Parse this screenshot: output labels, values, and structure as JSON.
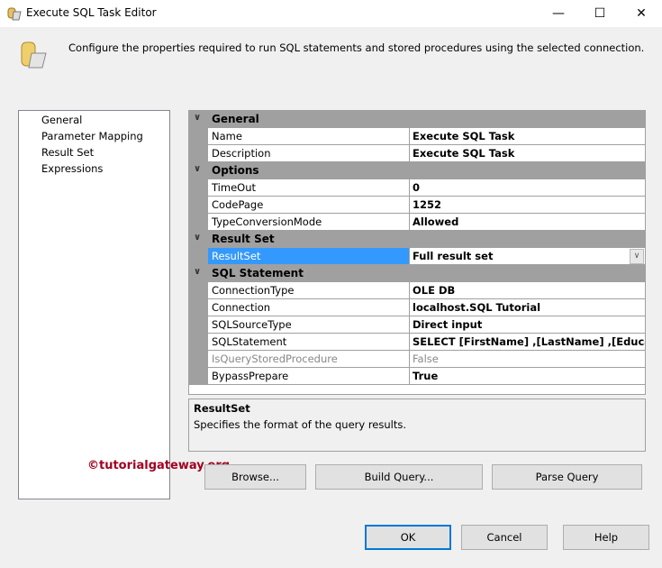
{
  "window": {
    "title": "Execute SQL Task Editor",
    "minimize": "—",
    "maximize": "☐",
    "close": "✕"
  },
  "header": {
    "text": "Configure the properties required to run SQL statements and stored procedures using the selected connection."
  },
  "nav": {
    "items": [
      "General",
      "Parameter Mapping",
      "Result Set",
      "Expressions"
    ]
  },
  "grid": {
    "general": {
      "label": "General",
      "rows": [
        {
          "name": "Name",
          "value": "Execute SQL Task"
        },
        {
          "name": "Description",
          "value": "Execute SQL Task"
        }
      ]
    },
    "options": {
      "label": "Options",
      "rows": [
        {
          "name": "TimeOut",
          "value": "0"
        },
        {
          "name": "CodePage",
          "value": "1252"
        },
        {
          "name": "TypeConversionMode",
          "value": "Allowed"
        }
      ]
    },
    "resultset": {
      "label": "Result Set",
      "rows": [
        {
          "name": "ResultSet",
          "value": "Full result set"
        }
      ]
    },
    "sql": {
      "label": "SQL Statement",
      "rows": [
        {
          "name": "ConnectionType",
          "value": "OLE DB"
        },
        {
          "name": "Connection",
          "value": "localhost.SQL Tutorial"
        },
        {
          "name": "SQLSourceType",
          "value": "Direct input"
        },
        {
          "name": "SQLStatement",
          "value": "SELECT [FirstName]      ,[LastName]      ,[Education]"
        },
        {
          "name": "IsQueryStoredProcedure",
          "value": "False"
        },
        {
          "name": "BypassPrepare",
          "value": "True"
        }
      ]
    }
  },
  "description": {
    "title": "ResultSet",
    "text": "Specifies the format of the query results."
  },
  "watermark": "©tutorialgateway.org",
  "buttons": {
    "browse": "Browse...",
    "build": "Build Query...",
    "parse": "Parse Query",
    "ok": "OK",
    "cancel": "Cancel",
    "help": "Help"
  },
  "colors": {
    "selection": "#3399ff",
    "category": "#a0a0a0",
    "watermark": "#a00020",
    "ok_border": "#0078d7"
  }
}
